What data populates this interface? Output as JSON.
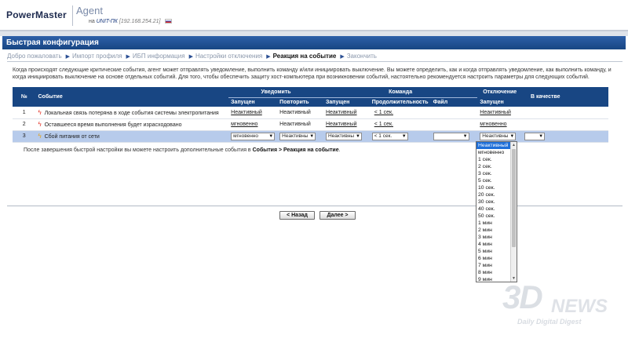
{
  "header": {
    "logo": "PowerMaster",
    "product": "Agent",
    "host_prefix": "на",
    "host_name": "UNIT-ПК",
    "host_ip": "[192.168.254.21]"
  },
  "page_title": "Быстрая конфигурация",
  "breadcrumbs": [
    "Добро пожаловать",
    "Импорт профиля",
    "ИБП информация",
    "Настройки отключения",
    "Реакция на событие",
    "Закончить"
  ],
  "intro": "Когда происходят следующие критические события, агент может отправлять уведомление, выполнить команду и/или инициировать выключение. Вы можете определить, как и когда отправлять уведомление, как выполнить команду, и когда инициировать выключение на основе отдельных событий. Для того, чтобы обеспечить защиту хост-компьютера при возникновении событий, настоятельно рекомендуется настроить параметры для следующих событий.",
  "table": {
    "headers": {
      "num": "№",
      "event": "Событие",
      "notify": "Уведомить",
      "command": "Команда",
      "shutdown": "Отключение",
      "as": "В качестве",
      "started": "Запущен",
      "repeat": "Повторить",
      "cmd_started": "Запущен",
      "duration": "Продолжительность",
      "file": "Файл",
      "sd_started": "Запущен"
    },
    "rows": [
      {
        "num": "1",
        "event": "Локальная связь потеряна в ходе события системы электропитания",
        "notify_started": "Неактивный",
        "repeat": "Неактивный",
        "cmd_started": "Неактивный",
        "duration": "< 1 сек.",
        "sd_started": "Неактивный"
      },
      {
        "num": "2",
        "event": "Оставшееся время выполнения будет израсходовано",
        "notify_started": "мгновенно",
        "repeat": "Неактивный",
        "cmd_started": "Неактивный",
        "duration": "< 1 сек.",
        "sd_started": "мгновенно"
      },
      {
        "num": "3",
        "event": "Сбой питания от сети",
        "notify_started": "мгновенно",
        "repeat": "Неактивны",
        "cmd_started": "Неактивны",
        "duration": "< 1 сек.",
        "file": "",
        "sd_started": "Неактивны",
        "as": ""
      }
    ]
  },
  "afternote": {
    "text": "После завершения быстрой настройки вы можете настроить дополнительные события в",
    "path": "События > Реакция на событие",
    "end": "."
  },
  "buttons": {
    "back": "< Назад",
    "next": "Далее >"
  },
  "dropdown": {
    "options": [
      "Неактивный",
      "мгновенно",
      "1 сек.",
      "2 сек.",
      "3 сек.",
      "5 сек.",
      "10 сек.",
      "20 сек.",
      "30 сек.",
      "40 сек.",
      "50 сек.",
      "1 мин",
      "2 мин",
      "3 мин",
      "4 мин",
      "5 мин",
      "6 мин",
      "7 мин",
      "8 мин",
      "9 мин"
    ],
    "highlighted_index": 0
  },
  "watermark": {
    "big": "3D",
    "news": "NEWS",
    "tagline": "Daily Digital Digest"
  },
  "colors": {
    "title_bar": "#184683",
    "selected_row": "#b7cbeb",
    "highlight": "#1e6fd9"
  }
}
